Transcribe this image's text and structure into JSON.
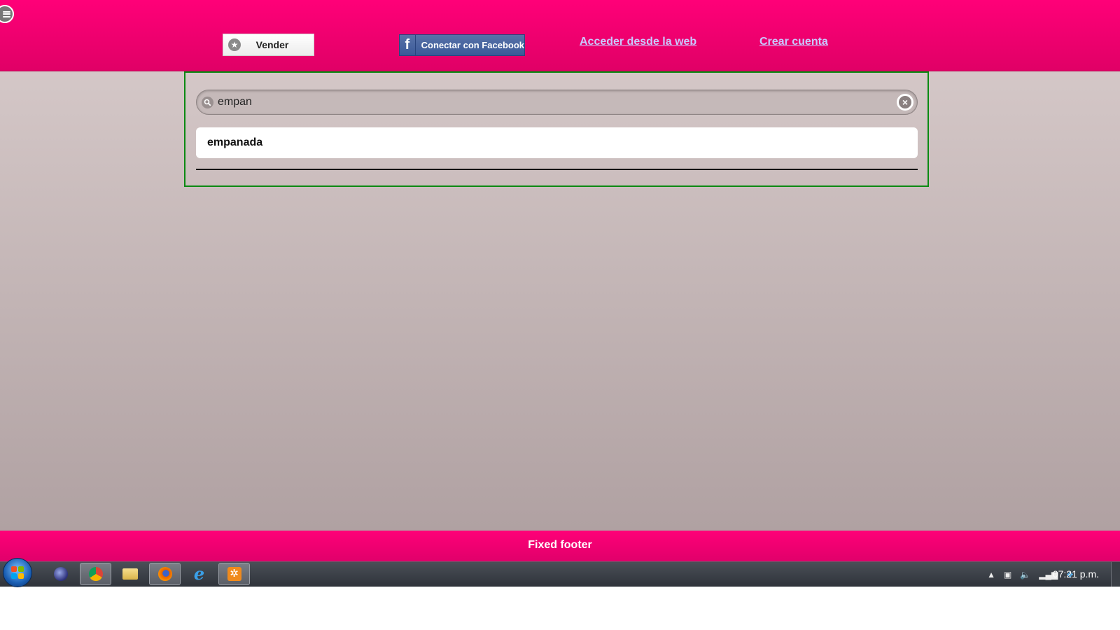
{
  "header": {
    "vender_label": "Vender",
    "facebook_label": "Conectar con Facebook",
    "link_web": "Acceder desde la web",
    "link_cuenta": "Crear cuenta"
  },
  "search": {
    "value": "empan",
    "suggestions": [
      "empanada"
    ]
  },
  "footer": {
    "text": "Fixed footer"
  },
  "taskbar": {
    "apps": [
      "eclipse-icon",
      "chrome-icon",
      "explorer-folder-icon",
      "firefox-icon",
      "internet-explorer-icon",
      "settings-app-icon"
    ],
    "clock": "07:21 p.m."
  },
  "colors": {
    "header_pink": "#ff0078",
    "panel_border": "#0a8a12",
    "link_color": "#c9c9ff",
    "facebook_blue": "#3b5998"
  }
}
